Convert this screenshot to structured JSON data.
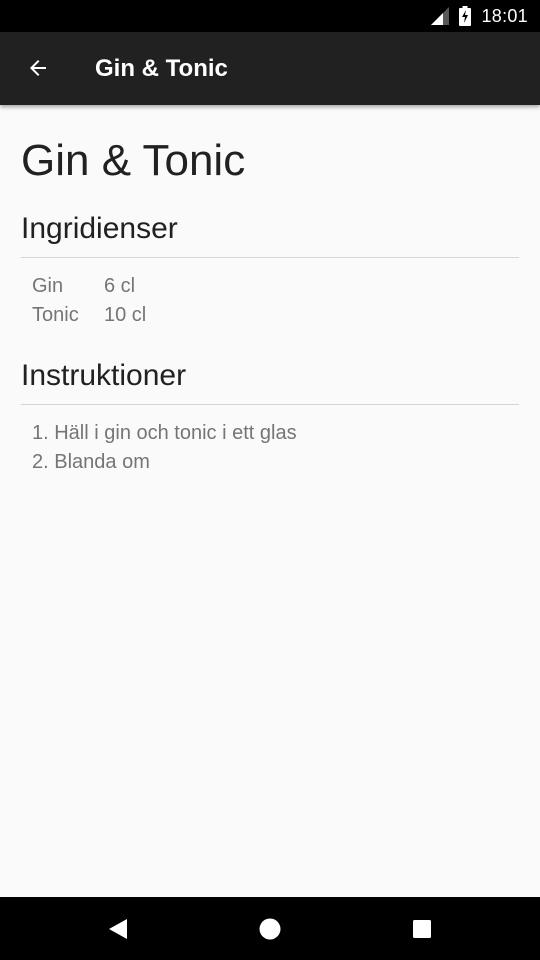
{
  "status_bar": {
    "time": "18:01",
    "icons": [
      "signal-icon",
      "battery-charging-icon"
    ]
  },
  "toolbar": {
    "back_icon": "arrow-back-icon",
    "title": "Gin & Tonic"
  },
  "recipe": {
    "title": "Gin & Tonic",
    "ingredients_heading": "Ingridienser",
    "ingredients": [
      {
        "name": "Gin",
        "amount": "6 cl"
      },
      {
        "name": "Tonic",
        "amount": "10 cl"
      }
    ],
    "instructions_heading": "Instruktioner",
    "instructions": [
      "1. Häll i gin och tonic i ett glas",
      "2. Blanda om"
    ]
  },
  "nav_bar": {
    "icons": [
      "nav-back-icon",
      "nav-home-icon",
      "nav-recents-icon"
    ]
  },
  "colors": {
    "status_bar": "#000000",
    "toolbar": "#212121",
    "background": "#fafafa",
    "primary_text": "#212121",
    "secondary_text": "#757575",
    "divider": "#d6d6d6"
  }
}
